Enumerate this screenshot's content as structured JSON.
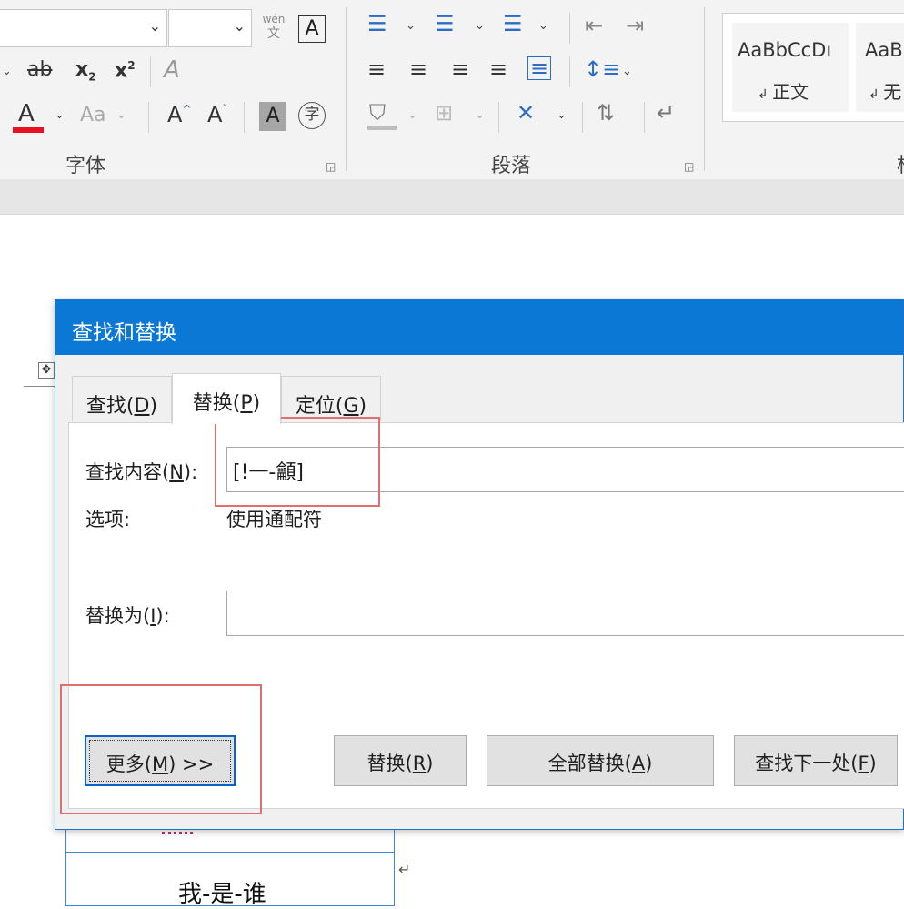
{
  "ribbon": {
    "font_group": {
      "label": "字体",
      "phonetic_guide_top": "wén",
      "phonetic_guide_bottom": "文",
      "char_border": "A",
      "strikethrough": "ab",
      "subscript_base": "x",
      "subscript_mark": "2",
      "superscript_base": "x",
      "superscript_mark": "2",
      "font_color": "A",
      "change_case": "Aa",
      "grow_font": "A",
      "shrink_font": "A",
      "char_shading": "A",
      "enclose_char": "字",
      "accent_red": "#e81123"
    },
    "paragraph_group": {
      "label": "段落"
    },
    "styles_group": {
      "style1_preview": "AaBbCcDı",
      "style1_name": "正文",
      "style2_preview": "AaB",
      "style2_name": "无",
      "partial_label": "柞"
    }
  },
  "dialog": {
    "title": "查找和替换",
    "tabs": [
      {
        "label": "查找(",
        "key": "D",
        "end": ")"
      },
      {
        "label": "替换(",
        "key": "P",
        "end": ")"
      },
      {
        "label": "定位(",
        "key": "G",
        "end": ")"
      }
    ],
    "find_label": "查找内容(",
    "find_key": "N",
    "find_end": "):",
    "find_value": "[!一-龥]",
    "options_label": "选项:",
    "options_value": "使用通配符",
    "replace_label": "替换为(",
    "replace_key": "I",
    "replace_end": "):",
    "replace_value": "",
    "buttons": {
      "more": "更多(",
      "more_key": "M",
      "more_end": ") >>",
      "replace": "替换(",
      "replace_key": "R",
      "replace_end": ")",
      "replace_all": "全部替换(",
      "replace_all_key": "A",
      "replace_all_end": ")",
      "find_next": "查找下一处(",
      "find_next_key": "F",
      "find_next_end": ")"
    },
    "accent_blue": "#0a78d4",
    "highlight_red": "#e07070"
  },
  "document": {
    "cell_text": "我-是-谁"
  }
}
